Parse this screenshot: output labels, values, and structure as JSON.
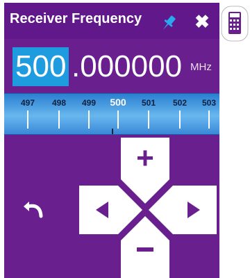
{
  "title_bar": {
    "title": "Receiver Frequency",
    "pin_icon": "pin-icon",
    "close_label": "✖"
  },
  "external": {
    "calculator_icon": "calculator-icon"
  },
  "frequency": {
    "integer_part": "500",
    "fraction_part": ".000000",
    "unit": "MHz"
  },
  "ruler": {
    "labels": [
      "497",
      "498",
      "499",
      "500",
      "501",
      "502",
      "503"
    ],
    "selected": "500"
  },
  "controls": {
    "back_icon": "undo-arrow-icon",
    "up_label": "+",
    "down_label": "−",
    "left_icon": "triangle-left-icon",
    "right_icon": "triangle-right-icon"
  },
  "colors": {
    "panel_background": "#6a1f8e",
    "titlebar_background": "#60188a",
    "highlight": "#1f9be0",
    "pin": "#2ba7ee",
    "ruler": "#69b7ee",
    "controls": "#ffffff",
    "calculator_accent": "#6a1f8e"
  }
}
